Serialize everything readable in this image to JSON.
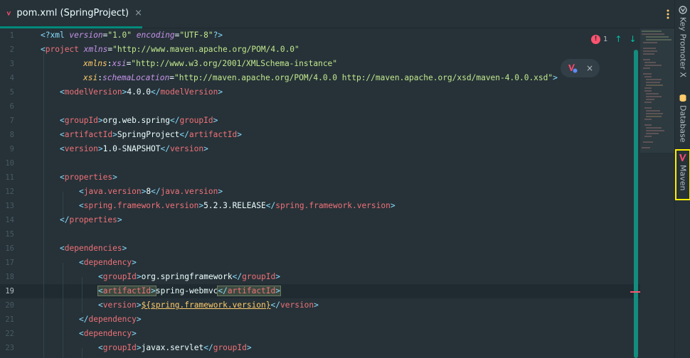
{
  "tab": {
    "title": "pom.xml (SpringProject)",
    "close": "×"
  },
  "gutter": {
    "numbers": [
      "1",
      "2",
      "3",
      "4",
      "5",
      "6",
      "7",
      "8",
      "9",
      "10",
      "11",
      "12",
      "13",
      "14",
      "15",
      "16",
      "17",
      "18",
      "19",
      "20",
      "21",
      "22",
      "23"
    ],
    "current_line": "19"
  },
  "inspection": {
    "error_count": "1",
    "up": "↑",
    "down": "↓"
  },
  "hint": {
    "close": "×"
  },
  "right_sidebar": {
    "key_promoter": "Key Promoter X",
    "database": "Database",
    "maven": "Maven"
  },
  "code": {
    "l1_pi_open": "<?xml ",
    "l1_version_attr": "version",
    "l1_version_val": "\"1.0\"",
    "l1_encoding_attr": "encoding",
    "l1_encoding_val": "\"UTF-8\"",
    "l1_pi_close": "?>",
    "l2_tag": "project",
    "l2_attr": "xmlns",
    "l2_val": "\"http://www.maven.apache.org/POM/4.0.0\"",
    "l3_ns": "xmlns",
    "l3_attr": "xsi",
    "l3_val": "\"http://www.w3.org/2001/XMLSchema-instance\"",
    "l4_ns": "xsi",
    "l4_attr": "schemaLocation",
    "l4_val": "\"http://maven.apache.org/POM/4.0.0 http://maven.apache.org/xsd/maven-4.0.0.xsd\"",
    "modelVersion_tag": "modelVersion",
    "modelVersion_val": "4.0.0",
    "groupId_tag": "groupId",
    "groupId_val": "org.web.spring",
    "artifactId_tag": "artifactId",
    "artifactId_val": "SpringProject",
    "version_tag": "version",
    "version_val": "1.0-SNAPSHOT",
    "properties_tag": "properties",
    "java_version_tag": "java.version",
    "java_version_val": "8",
    "spring_version_tag": "spring.framework.version",
    "spring_version_val": "5.2.3.RELEASE",
    "dependencies_tag": "dependencies",
    "dependency_tag": "dependency",
    "dep1_group": "org.springframework",
    "dep1_artifact": "spring-webmvc",
    "dep1_version_var": "${spring.framework.version}",
    "dep2_group": "javax.servlet"
  },
  "colors": {
    "accent": "#00897b",
    "error": "#ff5370",
    "highlight_box": "#ffee00"
  }
}
